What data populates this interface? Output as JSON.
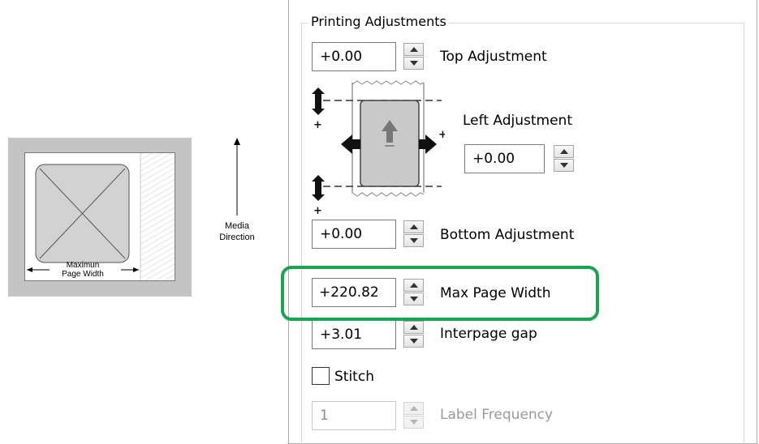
{
  "diagram": {
    "max_page_width_label_line1": "Maximun",
    "max_page_width_label_line2": "Page Width",
    "media_direction_line1": "Media",
    "media_direction_line2": "Direction"
  },
  "panel": {
    "group_title": "Printing Adjustments",
    "top_adjustment": {
      "value": "+0.00",
      "label": "Top Adjustment"
    },
    "left_adjustment": {
      "value": "+0.00",
      "label": "Left Adjustment"
    },
    "bottom_adjustment": {
      "value": "+0.00",
      "label": "Bottom Adjustment"
    },
    "max_page_width": {
      "value": "+220.82",
      "label": "Max Page Width"
    },
    "interpage_gap": {
      "value": "+3.01",
      "label": "Interpage gap"
    },
    "stitch": {
      "label": "Stitch",
      "checked": false
    },
    "label_frequency": {
      "value": "1",
      "label": "Label Frequency",
      "enabled": false
    }
  },
  "colors": {
    "highlight": "#1aa350",
    "disabled_text": "#9a9a9a"
  },
  "icons": [
    "spin-up-icon",
    "spin-down-icon",
    "media-direction-arrow-icon",
    "page-illustration"
  ]
}
